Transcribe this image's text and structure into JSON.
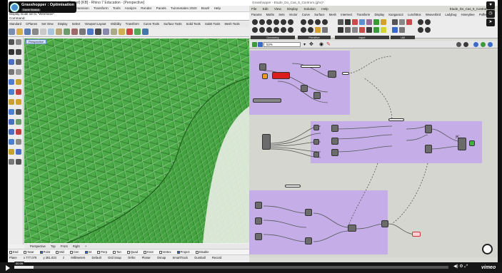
{
  "rhino": {
    "title": "(Saved) [KB] - Rhino 7 Education - [Perspective]",
    "menus": [
      "Solid",
      "Mesh",
      "Dimension",
      "Transform",
      "Tools",
      "Analyze",
      "Render",
      "Panels",
      "Tuinmetalen 2020",
      "Brazil",
      "Help"
    ],
    "command_history": "Display mode set to \"Wireframe\".",
    "command_prompt": "Command:",
    "toolbar_tabs": [
      "Standard",
      "CPlanes",
      "Set View",
      "Display",
      "Select",
      "Viewport Layout",
      "Visibility",
      "Transform",
      "Curve Tools",
      "Surface Tools",
      "Solid Tools",
      "SubD Tools",
      "Mesh Tools"
    ],
    "viewport_label": "Perspective",
    "viewport_tabs": [
      "Perspective",
      "Top",
      "Front",
      "Right",
      "+"
    ],
    "osnaps": [
      {
        "label": "End",
        "on": false
      },
      {
        "label": "Near",
        "on": false
      },
      {
        "label": "Point",
        "on": true
      },
      {
        "label": "Mid",
        "on": false
      },
      {
        "label": "Cen",
        "on": false
      },
      {
        "label": "Int",
        "on": true
      },
      {
        "label": "Perp",
        "on": false
      },
      {
        "label": "Tan",
        "on": false
      },
      {
        "label": "Quad",
        "on": false
      },
      {
        "label": "Knot",
        "on": false
      },
      {
        "label": "Vertex",
        "on": false
      },
      {
        "label": "Project",
        "on": true
      },
      {
        "label": "Disable",
        "on": false
      }
    ],
    "status": {
      "cplane": "Plane",
      "x": "x 777.078",
      "y": "y 281.023",
      "z": "z",
      "units": "Millimeters",
      "layer": "Default",
      "grid_snap": "Grid Snap",
      "ortho": "Ortho",
      "planar": "Planar",
      "osnap": "Osnap",
      "smarttrack": "SmartTrack",
      "gumball": "Gumball",
      "record": "Record"
    }
  },
  "overlay_badge": {
    "title": "Grasshopper : Optimisation",
    "user": "David Stasiuk"
  },
  "grasshopper": {
    "title": "Grasshopper - Etude_Do_Cas_5_Contrum.(ghx)*",
    "menus": [
      "File",
      "Edit",
      "View",
      "Display",
      "Solution",
      "Help"
    ],
    "doc_name": "Etude_Do_Cas_5_Contrum.Gelt",
    "tabs": [
      "Params",
      "Maths",
      "Sets",
      "Vector",
      "Curve",
      "Surface",
      "Mesh",
      "Intersect",
      "Transform",
      "Display",
      "Kangaroo2",
      "LunchBox",
      "Weaverbird",
      "Ladybug",
      "Honeybee",
      "Pufferfish"
    ],
    "groups": [
      "Geometry",
      "Primitive",
      "Input",
      "Util"
    ],
    "zoom": "52%"
  },
  "player": {
    "time": "00:39",
    "progress": 0.045,
    "brand": "vimeo"
  },
  "colors": {
    "viewport_bg": "#9ec79a",
    "mesh_green": "#3d9a3a",
    "group_purple": "#c3a9e8",
    "panel_red": "#d91c1c"
  }
}
